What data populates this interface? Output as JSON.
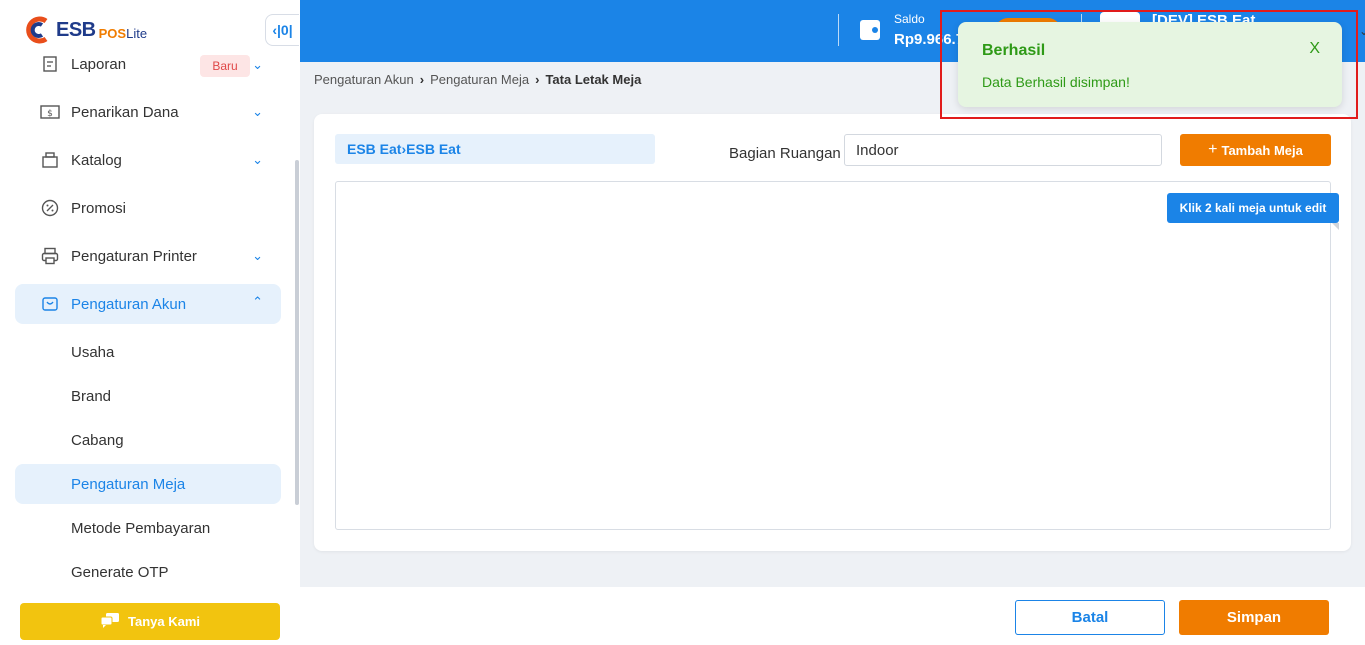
{
  "brand": {
    "logo_text": "ESB",
    "logo_sub_pos": "POS",
    "logo_sub_lite": "Lite"
  },
  "sidebar": {
    "collapse_icon": "sidebar-collapse-icon",
    "items": [
      {
        "label": "Laporan",
        "icon": "report-icon",
        "badge": "Baru"
      },
      {
        "label": "Penarikan Dana",
        "icon": "withdraw-icon"
      },
      {
        "label": "Katalog",
        "icon": "catalog-icon"
      },
      {
        "label": "Promosi",
        "icon": "percent-icon"
      },
      {
        "label": "Pengaturan Printer",
        "icon": "printer-icon"
      },
      {
        "label": "Pengaturan Akun",
        "icon": "account-settings-icon"
      }
    ],
    "sub_items": [
      {
        "label": "Usaha"
      },
      {
        "label": "Brand"
      },
      {
        "label": "Cabang"
      },
      {
        "label": "Pengaturan Meja"
      },
      {
        "label": "Metode Pembayaran"
      },
      {
        "label": "Generate OTP"
      }
    ],
    "help_button": "Tanya Kami"
  },
  "header": {
    "saldo_label": "Saldo",
    "saldo_value": "Rp9.966.7",
    "store_name": "[DEV] ESB Eat",
    "accent_color": "#1b84e7"
  },
  "breadcrumb": {
    "items": [
      "Pengaturan Akun",
      "Pengaturan Meja"
    ],
    "current": "Tata Letak Meja"
  },
  "layout_editor": {
    "brand_path_a": "ESB Eat",
    "brand_path_b": "ESB Eat",
    "room_label": "Bagian Ruangan",
    "room_value": "Indoor",
    "add_table_button": "Tambah Meja",
    "hint": "Klik 2 kali meja untuk edit"
  },
  "footer": {
    "cancel_button": "Batal",
    "save_button": "Simpan"
  },
  "toast": {
    "title": "Berhasil",
    "message": "Data Berhasil disimpan!",
    "close": "X",
    "color": "#2f9a17"
  }
}
